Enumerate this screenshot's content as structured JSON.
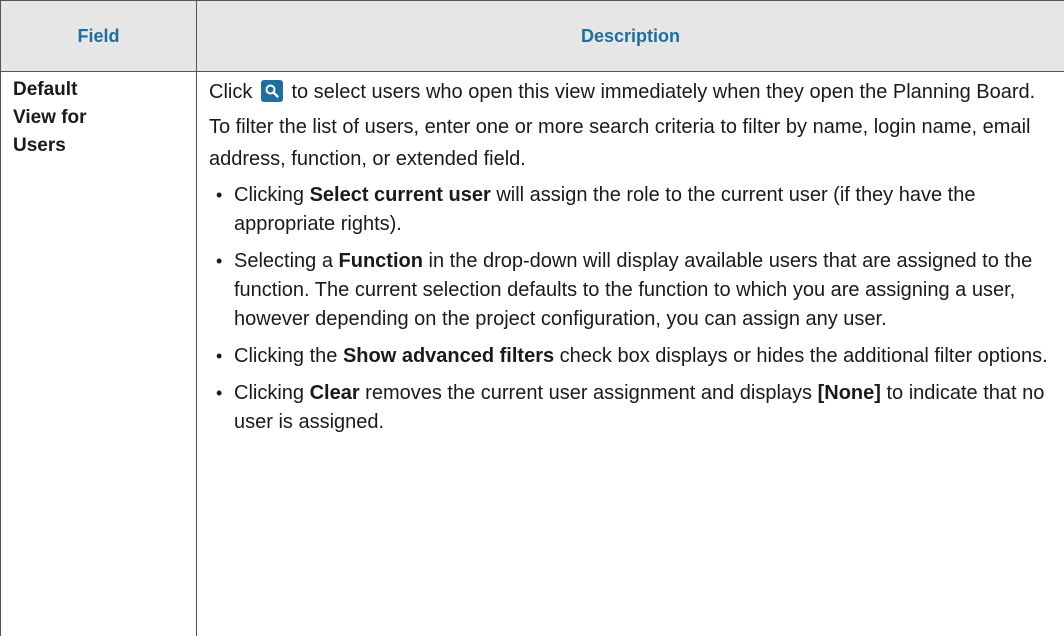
{
  "header": {
    "field_label": "Field",
    "description_label": "Description",
    "text_color": "#1f6f9c",
    "background": "#e6e6e6"
  },
  "row": {
    "field_lines": [
      "Default",
      "View for",
      "Users"
    ],
    "paragraph1": {
      "before_icon": "Click ",
      "icon": "search-icon",
      "after_icon": " to select users who open this view immediately when they open the Planning Board."
    },
    "paragraph2": "To filter the list of users, enter one or more search criteria to filter by name, login name, email address, function, or extended field.",
    "bullets": [
      {
        "pre": "Clicking ",
        "bold": "Select current user",
        "post": " will assign the role to the current user (if they have the appropriate rights)."
      },
      {
        "pre": "Selecting a ",
        "bold": "Function",
        "post": " in the drop-down will display available users that are assigned to the function. The current selection defaults to the function to which you are assigning a user, however depending on the project configuration, you can assign any user."
      },
      {
        "pre": "Clicking the ",
        "bold": "Show advanced filters",
        "post": " check box displays or hides the additional filter options."
      },
      {
        "pre": "Clicking ",
        "bold": "Clear",
        "post": " removes the current user assignment and displays ",
        "bold2": "[None]",
        "post2": " to indicate that no user is assigned."
      }
    ]
  }
}
